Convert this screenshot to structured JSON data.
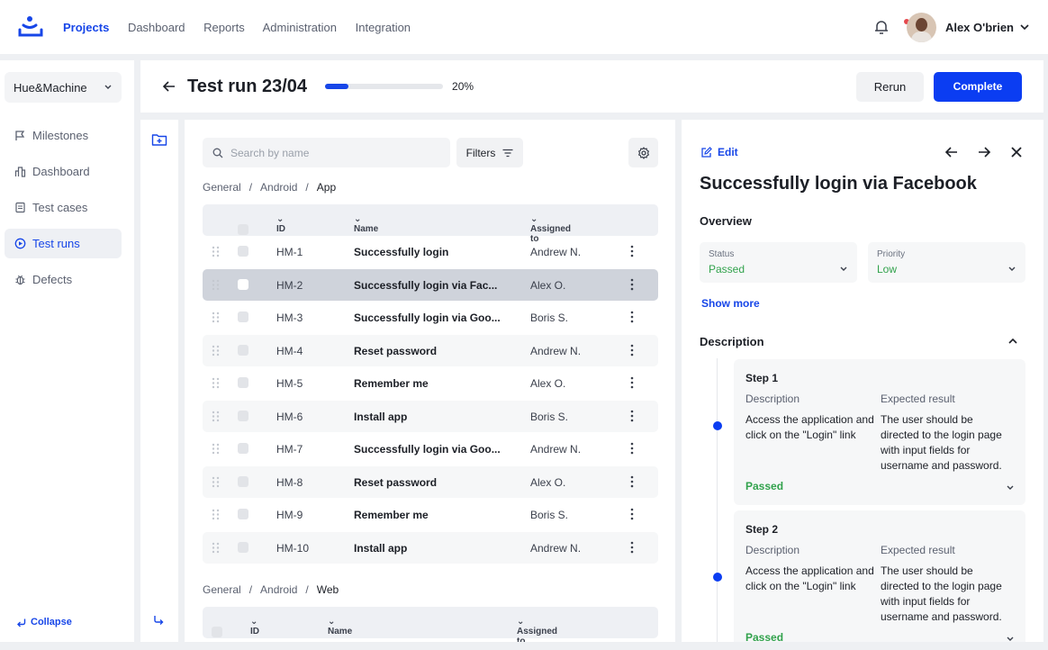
{
  "colors": {
    "accent": "#1746e8",
    "passed": "#31a24c"
  },
  "nav": {
    "items": [
      "Projects",
      "Dashboard",
      "Reports",
      "Administration",
      "Integration"
    ],
    "active": "Projects"
  },
  "user": {
    "name": "Alex O'brien"
  },
  "sidebar": {
    "workspace": "Hue&Machine",
    "items": [
      {
        "label": "Milestones",
        "icon": "flag-icon"
      },
      {
        "label": "Dashboard",
        "icon": "chart-icon"
      },
      {
        "label": "Test cases",
        "icon": "document-icon"
      },
      {
        "label": "Test runs",
        "icon": "play-circle-icon"
      },
      {
        "label": "Defects",
        "icon": "bug-icon"
      }
    ],
    "active": "Test runs",
    "collapse_label": "Collapse"
  },
  "header": {
    "title": "Test run 23/04",
    "progress_percent": 20,
    "progress_label": "20%",
    "rerun_label": "Rerun",
    "complete_label": "Complete"
  },
  "list": {
    "search_placeholder": "Search by name",
    "filters_label": "Filters",
    "columns": {
      "id": "ID",
      "name": "Name",
      "assigned": "Assigned to"
    },
    "breadcrumb_app": [
      "General",
      "Android",
      "App"
    ],
    "breadcrumb_web": [
      "General",
      "Android",
      "Web"
    ],
    "rows": [
      {
        "id": "HM-1",
        "name": "Successfully login",
        "assigned": "Andrew N."
      },
      {
        "id": "HM-2",
        "name": "Successfully login via Fac...",
        "assigned": "Alex O."
      },
      {
        "id": "HM-3",
        "name": "Successfully login via Goo...",
        "assigned": "Boris S."
      },
      {
        "id": "HM-4",
        "name": "Reset password",
        "assigned": "Andrew N."
      },
      {
        "id": "HM-5",
        "name": "Remember me",
        "assigned": "Alex O."
      },
      {
        "id": "HM-6",
        "name": "Install app",
        "assigned": "Boris S."
      },
      {
        "id": "HM-7",
        "name": "Successfully login via Goo...",
        "assigned": "Andrew N."
      },
      {
        "id": "HM-8",
        "name": "Reset password",
        "assigned": "Alex O."
      },
      {
        "id": "HM-9",
        "name": "Remember me",
        "assigned": "Boris S."
      },
      {
        "id": "HM-10",
        "name": "Install app",
        "assigned": "Andrew N."
      }
    ],
    "selected_id": "HM-2"
  },
  "detail": {
    "edit_label": "Edit",
    "title": "Successfully login via Facebook",
    "overview_label": "Overview",
    "status": {
      "label": "Status",
      "value": "Passed"
    },
    "priority": {
      "label": "Priority",
      "value": "Low"
    },
    "show_more": "Show more",
    "description_label": "Description",
    "steps": [
      {
        "name": "Step 1",
        "desc_label": "Description",
        "desc": "Access the application and click on the \"Login\" link",
        "exp_label": "Expected result",
        "exp": "The user should be directed to the login page with input fields for username and password.",
        "result": "Passed"
      },
      {
        "name": "Step 2",
        "desc_label": "Description",
        "desc": "Access the application and click on the \"Login\" link",
        "exp_label": "Expected result",
        "exp": "The user should be directed to the login page with input fields for username and password.",
        "result": "Passed"
      }
    ]
  }
}
